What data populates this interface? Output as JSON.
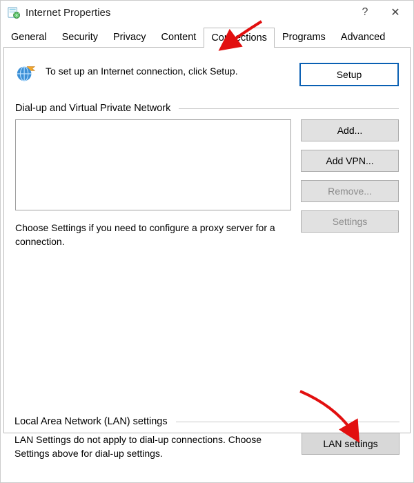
{
  "title": "Internet Properties",
  "help_symbol": "?",
  "close_symbol": "✕",
  "tabs": {
    "general": "General",
    "security": "Security",
    "privacy": "Privacy",
    "content": "Content",
    "connections": "Connections",
    "programs": "Programs",
    "advanced": "Advanced"
  },
  "setup": {
    "text": "To set up an Internet connection, click Setup.",
    "button": "Setup"
  },
  "dialup": {
    "heading": "Dial-up and Virtual Private Network",
    "add": "Add...",
    "addvpn": "Add VPN...",
    "remove": "Remove...",
    "settings": "Settings",
    "caption": "Choose Settings if you need to configure a proxy server for a connection."
  },
  "lan": {
    "heading": "Local Area Network (LAN) settings",
    "desc": "LAN Settings do not apply to dial-up connections. Choose Settings above for dial-up settings.",
    "button": "LAN settings"
  }
}
